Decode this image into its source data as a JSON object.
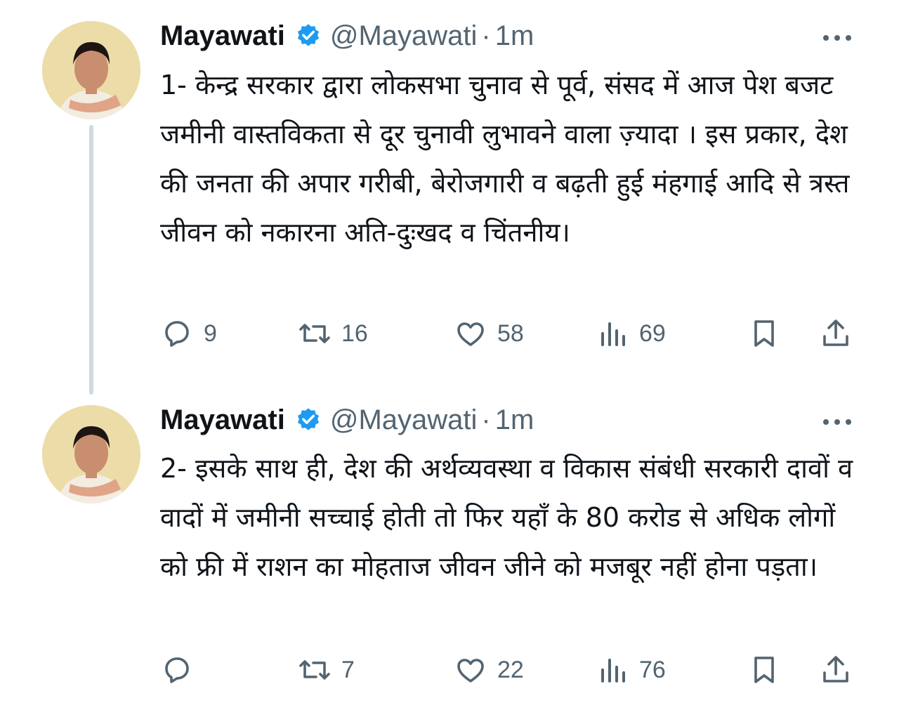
{
  "tweets": [
    {
      "author": "Mayawati",
      "handle": "@Mayawati",
      "separator": "·",
      "time": "1m",
      "text": "1- केन्द्र सरकार द्वारा लोकसभा चुनाव से पूर्व, संसद में आज पेश बजट जमीनी वास्तविकता से दूर चुनावी लुभावने वाला ज़्यादा । इस प्रकार, देश की जनता की अपार गरीबी, बेरोजगारी व बढ़ती हुई मंहगाई आदि से त्रस्त जीवन को नकारना अति-दुःखद व चिंतनीय।",
      "replies": "9",
      "retweets": "16",
      "likes": "58",
      "views": "69"
    },
    {
      "author": "Mayawati",
      "handle": "@Mayawati",
      "separator": "·",
      "time": "1m",
      "text": "2- इसके साथ ही, देश की अर्थव्यवस्था व विकास संबंधी सरकारी दावों व वादों में जमीनी सच्चाई होती तो फिर यहाँ के 80 करोड से अधिक लोगों को फ्री में राशन का मोहताज जीवन जीने को मजबूर नहीं होना पड़ता।",
      "replies": "",
      "retweets": "7",
      "likes": "22",
      "views": "76"
    }
  ],
  "icons": {
    "verified": "verified-badge-icon",
    "more": "more-icon",
    "reply": "reply-icon",
    "retweet": "retweet-icon",
    "like": "like-icon",
    "views": "views-icon",
    "bookmark": "bookmark-icon",
    "share": "share-icon"
  },
  "colors": {
    "text": "#0f1419",
    "secondary": "#536471",
    "verified": "#1d9bf0",
    "thread_line": "#cfd9de"
  }
}
